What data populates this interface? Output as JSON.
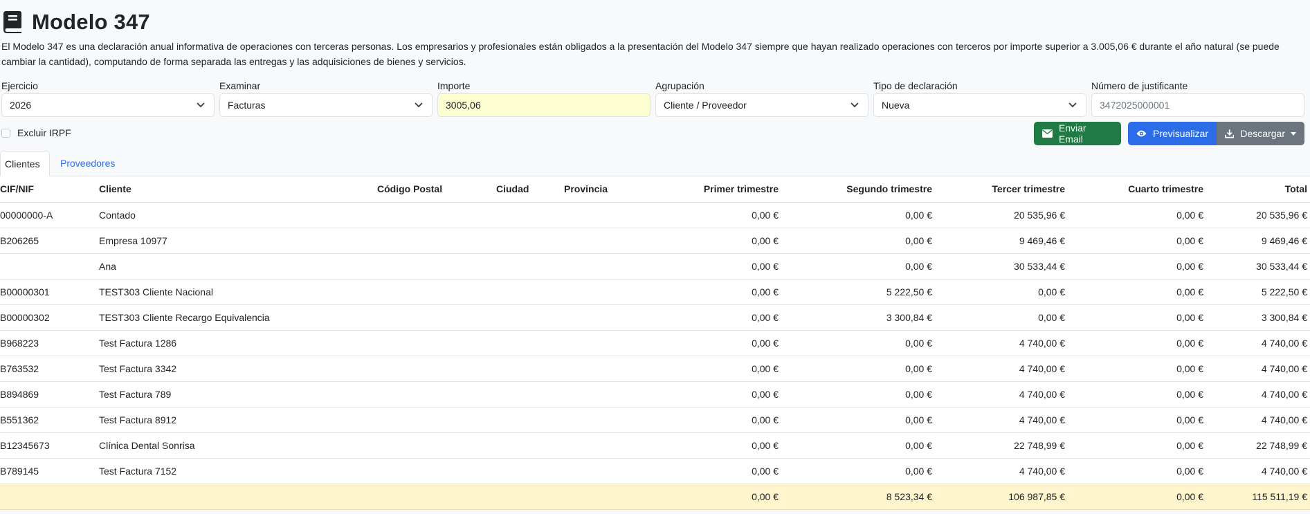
{
  "header": {
    "title": "Modelo 347",
    "description": "El Modelo 347 es una declaración anual informativa de operaciones con terceras personas. Los empresarios y profesionales están obligados a la presentación del Modelo 347 siempre que hayan realizado operaciones con terceros por importe superior a 3.005,06 € durante el año natural (se puede cambiar la cantidad), computando de forma separada las entregas y las adquisiciones de bienes y servicios."
  },
  "filters": {
    "ejercicio": {
      "label": "Ejercicio",
      "value": "2026"
    },
    "examinar": {
      "label": "Examinar",
      "value": "Facturas"
    },
    "importe": {
      "label": "Importe",
      "value": "3005,06"
    },
    "agrupacion": {
      "label": "Agrupación",
      "value": "Cliente / Proveedor"
    },
    "tipo": {
      "label": "Tipo de declaración",
      "value": "Nueva"
    },
    "justificante": {
      "label": "Número de justificante",
      "placeholder": "3472025000001"
    },
    "excluir_irpf": {
      "label": "Excluir IRPF",
      "checked": false
    }
  },
  "actions": {
    "email_label": "Enviar Email",
    "preview_label": "Previsualizar",
    "download_label": "Descargar"
  },
  "tabs": [
    {
      "label": "Clientes",
      "active": true
    },
    {
      "label": "Proveedores",
      "active": false
    }
  ],
  "table": {
    "columns": {
      "cif": "CIF/NIF",
      "cliente": "Cliente",
      "cp": "Código Postal",
      "ciudad": "Ciudad",
      "provincia": "Provincia",
      "q1": "Primer trimestre",
      "q2": "Segundo trimestre",
      "q3": "Tercer trimestre",
      "q4": "Cuarto trimestre",
      "total": "Total"
    },
    "rows": [
      {
        "cif": "00000000-A",
        "cliente": "Contado",
        "q1": "0,00 €",
        "q2": "0,00 €",
        "q3": "20 535,96 €",
        "q4": "0,00 €",
        "total": "20 535,96 €"
      },
      {
        "cif": "B206265",
        "cliente": "Empresa 10977",
        "q1": "0,00 €",
        "q2": "0,00 €",
        "q3": "9 469,46 €",
        "q4": "0,00 €",
        "total": "9 469,46 €"
      },
      {
        "cif": "",
        "cliente": "Ana",
        "q1": "0,00 €",
        "q2": "0,00 €",
        "q3": "30 533,44 €",
        "q4": "0,00 €",
        "total": "30 533,44 €"
      },
      {
        "cif": "B00000301",
        "cliente": "TEST303 Cliente Nacional",
        "q1": "0,00 €",
        "q2": "5 222,50 €",
        "q3": "0,00 €",
        "q4": "0,00 €",
        "total": "5 222,50 €"
      },
      {
        "cif": "B00000302",
        "cliente": "TEST303 Cliente Recargo Equivalencia",
        "q1": "0,00 €",
        "q2": "3 300,84 €",
        "q3": "0,00 €",
        "q4": "0,00 €",
        "total": "3 300,84 €"
      },
      {
        "cif": "B968223",
        "cliente": "Test Factura 1286",
        "q1": "0,00 €",
        "q2": "0,00 €",
        "q3": "4 740,00 €",
        "q4": "0,00 €",
        "total": "4 740,00 €"
      },
      {
        "cif": "B763532",
        "cliente": "Test Factura 3342",
        "q1": "0,00 €",
        "q2": "0,00 €",
        "q3": "4 740,00 €",
        "q4": "0,00 €",
        "total": "4 740,00 €"
      },
      {
        "cif": "B894869",
        "cliente": "Test Factura 789",
        "q1": "0,00 €",
        "q2": "0,00 €",
        "q3": "4 740,00 €",
        "q4": "0,00 €",
        "total": "4 740,00 €"
      },
      {
        "cif": "B551362",
        "cliente": "Test Factura 8912",
        "q1": "0,00 €",
        "q2": "0,00 €",
        "q3": "4 740,00 €",
        "q4": "0,00 €",
        "total": "4 740,00 €"
      },
      {
        "cif": "B12345673",
        "cliente": "Clínica Dental Sonrisa",
        "q1": "0,00 €",
        "q2": "0,00 €",
        "q3": "22 748,99 €",
        "q4": "0,00 €",
        "total": "22 748,99 €"
      },
      {
        "cif": "B789145",
        "cliente": "Test Factura 7152",
        "q1": "0,00 €",
        "q2": "0,00 €",
        "q3": "4 740,00 €",
        "q4": "0,00 €",
        "total": "4 740,00 €"
      }
    ],
    "totals": {
      "q1": "0,00 €",
      "q2": "8 523,34 €",
      "q3": "106 987,85 €",
      "q4": "0,00 €",
      "total": "115 511,19 €"
    }
  },
  "icons": {
    "title": "book-icon",
    "select": "chevron-down-icon",
    "email": "envelope-icon",
    "preview": "eye-icon",
    "download": "download-icon"
  },
  "colors": {
    "primary": "#2b6de8",
    "success": "#1f7a43",
    "secondary": "#6c757d",
    "importe_bg": "#fdfdd2",
    "totals_bg": "#fff4cc"
  }
}
